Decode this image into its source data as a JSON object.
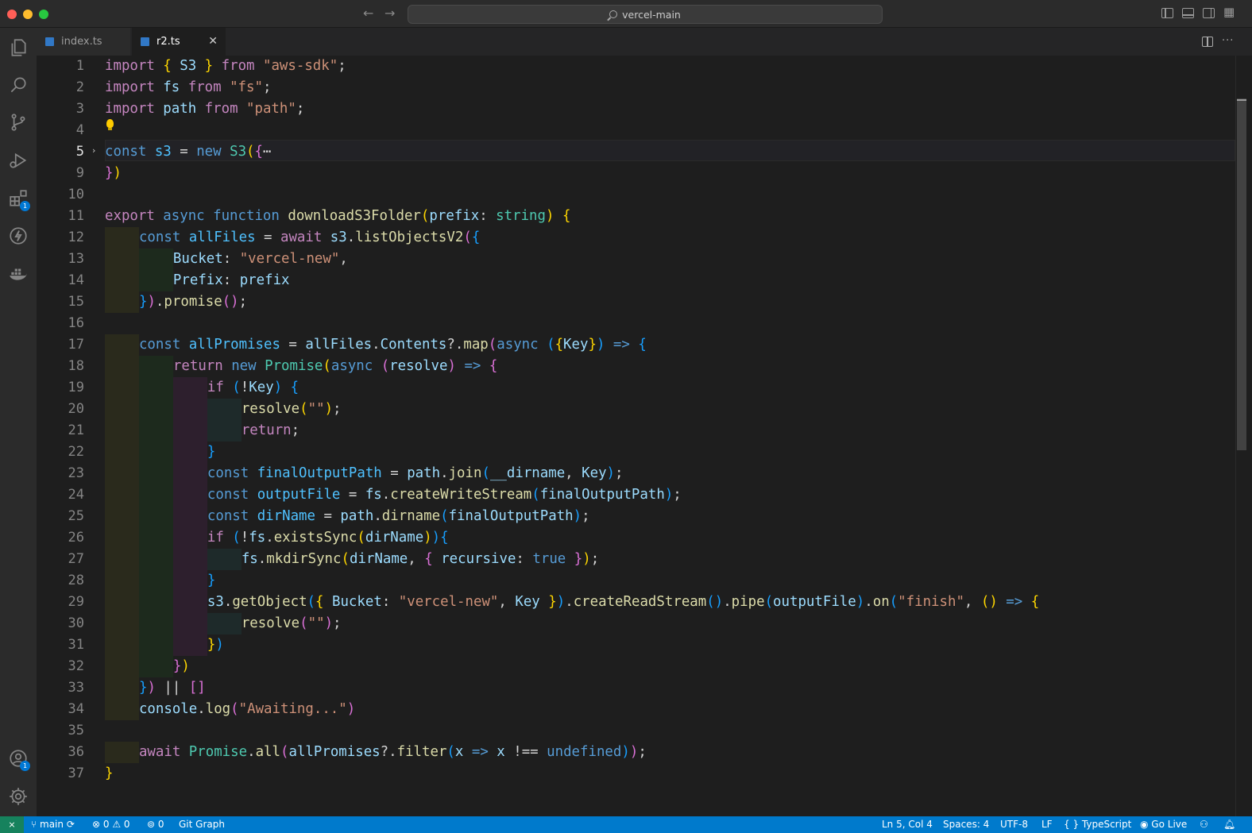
{
  "window": {
    "search_label": "vercel-main"
  },
  "tabs": [
    {
      "label": "index.ts",
      "icon": "typescript-icon",
      "active": false
    },
    {
      "label": "r2.ts",
      "icon": "typescript-icon",
      "active": true
    }
  ],
  "activity_bar": {
    "items": [
      "explorer-icon",
      "search-icon",
      "source-control-icon",
      "run-debug-icon",
      "extensions-icon",
      "thunder-client-icon",
      "docker-icon"
    ],
    "extensions_badge": "1",
    "accounts_badge": "1"
  },
  "editor": {
    "lines": [
      {
        "n": "1"
      },
      {
        "n": "2"
      },
      {
        "n": "3"
      },
      {
        "n": "4"
      },
      {
        "n": "5"
      },
      {
        "n": "9"
      },
      {
        "n": "10"
      },
      {
        "n": "11"
      },
      {
        "n": "12"
      },
      {
        "n": "13"
      },
      {
        "n": "14"
      },
      {
        "n": "15"
      },
      {
        "n": "16"
      },
      {
        "n": "17"
      },
      {
        "n": "18"
      },
      {
        "n": "19"
      },
      {
        "n": "20"
      },
      {
        "n": "21"
      },
      {
        "n": "22"
      },
      {
        "n": "23"
      },
      {
        "n": "24"
      },
      {
        "n": "25"
      },
      {
        "n": "26"
      },
      {
        "n": "27"
      },
      {
        "n": "28"
      },
      {
        "n": "29"
      },
      {
        "n": "30"
      },
      {
        "n": "31"
      },
      {
        "n": "32"
      },
      {
        "n": "33"
      },
      {
        "n": "34"
      },
      {
        "n": "35"
      },
      {
        "n": "36"
      },
      {
        "n": "37"
      }
    ],
    "active_line": "5",
    "code": [
      [
        [
          "k",
          "import "
        ],
        [
          "p1",
          "{ "
        ],
        [
          "v",
          "S3"
        ],
        [
          "p1",
          " }"
        ],
        [
          "k",
          " from "
        ],
        [
          "s",
          "\"aws-sdk\""
        ],
        [
          "o",
          ";"
        ]
      ],
      [
        [
          "k",
          "import "
        ],
        [
          "v",
          "fs"
        ],
        [
          "k",
          " from "
        ],
        [
          "s",
          "\"fs\""
        ],
        [
          "o",
          ";"
        ]
      ],
      [
        [
          "k",
          "import "
        ],
        [
          "v",
          "path"
        ],
        [
          "k",
          " from "
        ],
        [
          "s",
          "\"path\""
        ],
        [
          "o",
          ";"
        ]
      ],
      [],
      [
        [
          "b",
          "const "
        ],
        [
          "c",
          "s3"
        ],
        [
          "o",
          " = "
        ],
        [
          "b",
          "new "
        ],
        [
          "t",
          "S3"
        ],
        [
          "p1",
          "("
        ],
        [
          "p2",
          "{"
        ],
        [
          "o",
          "⋯"
        ]
      ],
      [
        [
          "p2",
          "}"
        ],
        [
          "p1",
          ")"
        ]
      ],
      [],
      [
        [
          "k",
          "export "
        ],
        [
          "b",
          "async function "
        ],
        [
          "f",
          "downloadS3Folder"
        ],
        [
          "p1",
          "("
        ],
        [
          "v",
          "prefix"
        ],
        [
          "o",
          ": "
        ],
        [
          "t",
          "string"
        ],
        [
          "p1",
          ")"
        ],
        [
          "o",
          " "
        ],
        [
          "p1",
          "{"
        ]
      ],
      [
        [
          "b",
          "const "
        ],
        [
          "c",
          "allFiles"
        ],
        [
          "o",
          " = "
        ],
        [
          "k",
          "await "
        ],
        [
          "v",
          "s3"
        ],
        [
          "o",
          "."
        ],
        [
          "f",
          "listObjectsV2"
        ],
        [
          "p2",
          "("
        ],
        [
          "p3",
          "{"
        ]
      ],
      [
        [
          "v",
          "Bucket"
        ],
        [
          "o",
          ": "
        ],
        [
          "s",
          "\"vercel-new\""
        ],
        [
          "o",
          ","
        ]
      ],
      [
        [
          "v",
          "Prefix"
        ],
        [
          "o",
          ": "
        ],
        [
          "v",
          "prefix"
        ]
      ],
      [
        [
          "p3",
          "}"
        ],
        [
          "p2",
          ")"
        ],
        [
          "o",
          "."
        ],
        [
          "f",
          "promise"
        ],
        [
          "p2",
          "()"
        ],
        [
          "o",
          ";"
        ]
      ],
      [],
      [
        [
          "b",
          "const "
        ],
        [
          "c",
          "allPromises"
        ],
        [
          "o",
          " = "
        ],
        [
          "v",
          "allFiles"
        ],
        [
          "o",
          "."
        ],
        [
          "v",
          "Contents"
        ],
        [
          "o",
          "?."
        ],
        [
          "f",
          "map"
        ],
        [
          "p2",
          "("
        ],
        [
          "b",
          "async "
        ],
        [
          "p3",
          "("
        ],
        [
          "p1",
          "{"
        ],
        [
          "v",
          "Key"
        ],
        [
          "p1",
          "}"
        ],
        [
          "p3",
          ")"
        ],
        [
          "b",
          " => "
        ],
        [
          "p3",
          "{"
        ]
      ],
      [
        [
          "k",
          "return "
        ],
        [
          "b",
          "new "
        ],
        [
          "t",
          "Promise"
        ],
        [
          "p1",
          "("
        ],
        [
          "b",
          "async "
        ],
        [
          "p2",
          "("
        ],
        [
          "v",
          "resolve"
        ],
        [
          "p2",
          ")"
        ],
        [
          "b",
          " => "
        ],
        [
          "p2",
          "{"
        ]
      ],
      [
        [
          "k",
          "if "
        ],
        [
          "p3",
          "("
        ],
        [
          "o",
          "!"
        ],
        [
          "v",
          "Key"
        ],
        [
          "p3",
          ")"
        ],
        [
          "o",
          " "
        ],
        [
          "p3",
          "{"
        ]
      ],
      [
        [
          "f",
          "resolve"
        ],
        [
          "p1",
          "("
        ],
        [
          "s",
          "\"\""
        ],
        [
          "p1",
          ")"
        ],
        [
          "o",
          ";"
        ]
      ],
      [
        [
          "k",
          "return"
        ],
        [
          "o",
          ";"
        ]
      ],
      [
        [
          "p3",
          "}"
        ]
      ],
      [
        [
          "b",
          "const "
        ],
        [
          "c",
          "finalOutputPath"
        ],
        [
          "o",
          " = "
        ],
        [
          "v",
          "path"
        ],
        [
          "o",
          "."
        ],
        [
          "f",
          "join"
        ],
        [
          "p3",
          "("
        ],
        [
          "v",
          "__dirname"
        ],
        [
          "o",
          ", "
        ],
        [
          "v",
          "Key"
        ],
        [
          "p3",
          ")"
        ],
        [
          "o",
          ";"
        ]
      ],
      [
        [
          "b",
          "const "
        ],
        [
          "c",
          "outputFile"
        ],
        [
          "o",
          " = "
        ],
        [
          "v",
          "fs"
        ],
        [
          "o",
          "."
        ],
        [
          "f",
          "createWriteStream"
        ],
        [
          "p3",
          "("
        ],
        [
          "v",
          "finalOutputPath"
        ],
        [
          "p3",
          ")"
        ],
        [
          "o",
          ";"
        ]
      ],
      [
        [
          "b",
          "const "
        ],
        [
          "c",
          "dirName"
        ],
        [
          "o",
          " = "
        ],
        [
          "v",
          "path"
        ],
        [
          "o",
          "."
        ],
        [
          "f",
          "dirname"
        ],
        [
          "p3",
          "("
        ],
        [
          "v",
          "finalOutputPath"
        ],
        [
          "p3",
          ")"
        ],
        [
          "o",
          ";"
        ]
      ],
      [
        [
          "k",
          "if "
        ],
        [
          "p3",
          "("
        ],
        [
          "o",
          "!"
        ],
        [
          "v",
          "fs"
        ],
        [
          "o",
          "."
        ],
        [
          "f",
          "existsSync"
        ],
        [
          "p1",
          "("
        ],
        [
          "v",
          "dirName"
        ],
        [
          "p1",
          ")"
        ],
        [
          "p3",
          ")"
        ],
        [
          "p3",
          "{"
        ]
      ],
      [
        [
          "v",
          "fs"
        ],
        [
          "o",
          "."
        ],
        [
          "f",
          "mkdirSync"
        ],
        [
          "p1",
          "("
        ],
        [
          "v",
          "dirName"
        ],
        [
          "o",
          ", "
        ],
        [
          "p2",
          "{ "
        ],
        [
          "v",
          "recursive"
        ],
        [
          "o",
          ": "
        ],
        [
          "b",
          "true"
        ],
        [
          "p2",
          " }"
        ],
        [
          "p1",
          ")"
        ],
        [
          "o",
          ";"
        ]
      ],
      [
        [
          "p3",
          "}"
        ]
      ],
      [
        [
          "v",
          "s3"
        ],
        [
          "o",
          "."
        ],
        [
          "f",
          "getObject"
        ],
        [
          "p3",
          "("
        ],
        [
          "p1",
          "{ "
        ],
        [
          "v",
          "Bucket"
        ],
        [
          "o",
          ": "
        ],
        [
          "s",
          "\"vercel-new\""
        ],
        [
          "o",
          ", "
        ],
        [
          "v",
          "Key"
        ],
        [
          "p1",
          " }"
        ],
        [
          "p3",
          ")"
        ],
        [
          "o",
          "."
        ],
        [
          "f",
          "createReadStream"
        ],
        [
          "p3",
          "()"
        ],
        [
          "o",
          "."
        ],
        [
          "f",
          "pipe"
        ],
        [
          "p3",
          "("
        ],
        [
          "v",
          "outputFile"
        ],
        [
          "p3",
          ")"
        ],
        [
          "o",
          "."
        ],
        [
          "f",
          "on"
        ],
        [
          "p3",
          "("
        ],
        [
          "s",
          "\"finish\""
        ],
        [
          "o",
          ", "
        ],
        [
          "p1",
          "()"
        ],
        [
          "b",
          " => "
        ],
        [
          "p1",
          "{"
        ]
      ],
      [
        [
          "f",
          "resolve"
        ],
        [
          "p2",
          "("
        ],
        [
          "s",
          "\"\""
        ],
        [
          "p2",
          ")"
        ],
        [
          "o",
          ";"
        ]
      ],
      [
        [
          "p1",
          "}"
        ],
        [
          "p3",
          ")"
        ]
      ],
      [
        [
          "p2",
          "}"
        ],
        [
          "p1",
          ")"
        ]
      ],
      [
        [
          "p3",
          "}"
        ],
        [
          "p2",
          ")"
        ],
        [
          "o",
          " || "
        ],
        [
          "p2",
          "[]"
        ]
      ],
      [
        [
          "v",
          "console"
        ],
        [
          "o",
          "."
        ],
        [
          "f",
          "log"
        ],
        [
          "p2",
          "("
        ],
        [
          "s",
          "\"Awaiting...\""
        ],
        [
          "p2",
          ")"
        ]
      ],
      [],
      [
        [
          "k",
          "await "
        ],
        [
          "t",
          "Promise"
        ],
        [
          "o",
          "."
        ],
        [
          "f",
          "all"
        ],
        [
          "p2",
          "("
        ],
        [
          "v",
          "allPromises"
        ],
        [
          "o",
          "?."
        ],
        [
          "f",
          "filter"
        ],
        [
          "p3",
          "("
        ],
        [
          "v",
          "x"
        ],
        [
          "b",
          " => "
        ],
        [
          "v",
          "x"
        ],
        [
          "o",
          " !== "
        ],
        [
          "b",
          "undefined"
        ],
        [
          "p3",
          ")"
        ],
        [
          "p2",
          ")"
        ],
        [
          "o",
          ";"
        ]
      ],
      [
        [
          "p1",
          "}"
        ]
      ]
    ]
  },
  "statusbar": {
    "branch": "main",
    "errors": "0",
    "warnings": "0",
    "ports": "0",
    "git_graph": "Git Graph",
    "cursor": "Ln 5, Col 4",
    "spaces": "Spaces: 4",
    "encoding": "UTF-8",
    "eol": "LF",
    "language": "TypeScript",
    "go_live": "Go Live"
  }
}
